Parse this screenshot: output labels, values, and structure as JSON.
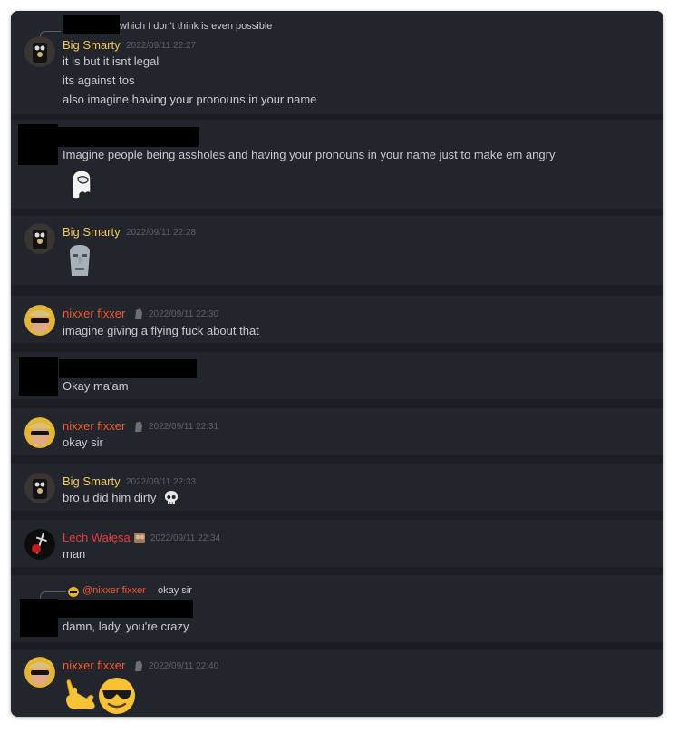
{
  "messages": [
    {
      "reply_text": "which I don't think is even possible",
      "author": "Big Smarty",
      "timestamp": "2022/09/11 22:27",
      "lines": [
        "it is but it isnt legal",
        "its against tos",
        "also imagine having your pronouns in your name"
      ]
    },
    {
      "lines": [
        "Imagine people being assholes and having your pronouns in your name just to make em angry"
      ],
      "attachment": "among-us-ghost-sticker"
    },
    {
      "author": "Big Smarty",
      "timestamp": "2022/09/11 22:28",
      "attachment": "moai-emoji"
    },
    {
      "author": "nixxer fixxer",
      "timestamp": "2022/09/11 22:30",
      "lines": [
        "imagine giving a flying fuck about that"
      ]
    },
    {
      "lines": [
        "Okay ma'am"
      ]
    },
    {
      "author": "nixxer fixxer",
      "timestamp": "2022/09/11 22:31",
      "lines": [
        "okay sir"
      ]
    },
    {
      "author": "Big Smarty",
      "timestamp": "2022/09/11 22:33",
      "lines": [
        "bro u did him dirty"
      ],
      "inline_emoji": "skull-emoji"
    },
    {
      "author": "Lech Wałęsa",
      "timestamp": "2022/09/11 22:34",
      "lines": [
        "man"
      ]
    },
    {
      "reply_author": "@nixxer fixxer",
      "reply_text": "okay sir",
      "lines": [
        "damn, lady, you're crazy"
      ]
    },
    {
      "author": "nixxer fixxer",
      "timestamp": "2022/09/11 22:40",
      "attachment": "call-me-hand-and-sunglasses-emojis"
    }
  ],
  "colors": {
    "big_smarty": "#f0c75e",
    "nixxer_fixxer": "#ee5a2f",
    "lech_walesa": "#e83a3a",
    "background": "#1c1e24",
    "message_background": "#23252c",
    "text": "#c8cace",
    "timestamp": "#5c5f69"
  }
}
